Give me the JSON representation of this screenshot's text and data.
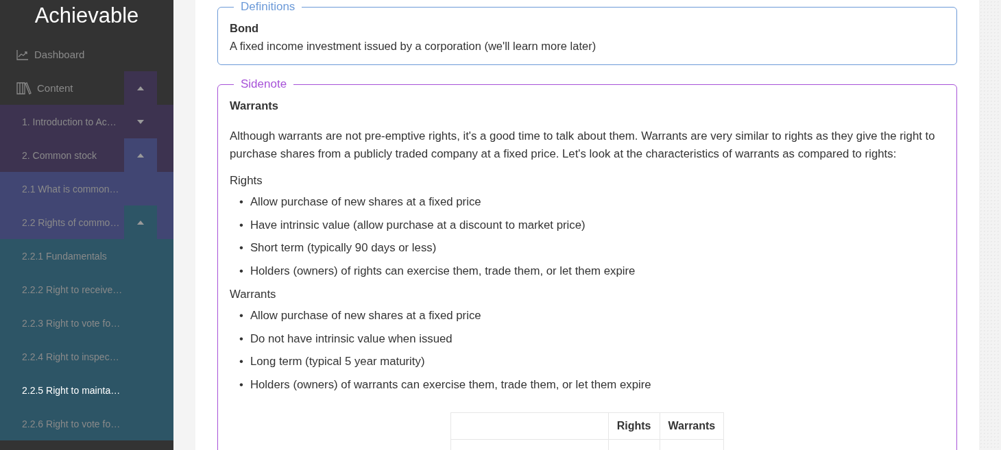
{
  "sidebar": {
    "logo": "Achievable",
    "items": [
      {
        "label": "Dashboard",
        "selected": false
      },
      {
        "label": "Content",
        "selected": false,
        "expanded": true,
        "children": [
          {
            "label": "1. Introduction to Ac…",
            "selected": false,
            "expanded": false
          },
          {
            "label": "2. Common stock",
            "selected": false,
            "expanded": true,
            "children": [
              {
                "label": "2.1 What is common…",
                "selected": false
              },
              {
                "label": "2.2 Rights of commo…",
                "selected": false,
                "expanded": true,
                "children": [
                  {
                    "label": "2.2.1 Fundamentals",
                    "selected": false
                  },
                  {
                    "label": "2.2.2 Right to receive…",
                    "selected": false
                  },
                  {
                    "label": "2.2.3 Right to vote fo…",
                    "selected": false
                  },
                  {
                    "label": "2.2.4 Right to inspec…",
                    "selected": false
                  },
                  {
                    "label": "2.2.5 Right to mainta…",
                    "selected": true
                  },
                  {
                    "label": "2.2.6 Right to vote fo…",
                    "selected": false
                  }
                ]
              }
            ]
          }
        ]
      }
    ]
  },
  "callouts": [
    {
      "kind": "definitions",
      "legend": "Definitions",
      "term": "Bond",
      "text": "A fixed income investment issued by a corporation (we'll learn more later)"
    },
    {
      "kind": "sidenote",
      "legend": "Sidenote",
      "heading": "Warrants",
      "paragraph": "Although warrants are not pre-emptive rights, it's a good time to talk about them. Warrants are very similar to rights as they give the right to purchase shares from a publicly traded company at a fixed price. Let's look at the characteristics of warrants as compared to rights:",
      "lists": [
        {
          "title": "Rights",
          "marker": "•",
          "items": [
            "Allow purchase of new shares at a fixed price",
            "Have intrinsic value (allow purchase at a discount to market price)",
            "Short term (typically 90 days or less)",
            "Holders (owners) of rights can exercise them, trade them, or let them expire"
          ]
        },
        {
          "title": "Warrants",
          "marker": "•",
          "items": [
            "Allow purchase of new shares at a fixed price",
            "Do not have intrinsic value when issued",
            "Long term (typical 5 year maturity)",
            "Holders (owners) of warrants can exercise them, trade them, or let them expire"
          ]
        }
      ],
      "table": {
        "columns": [
          "Rights",
          "Warrants"
        ]
      }
    }
  ]
}
